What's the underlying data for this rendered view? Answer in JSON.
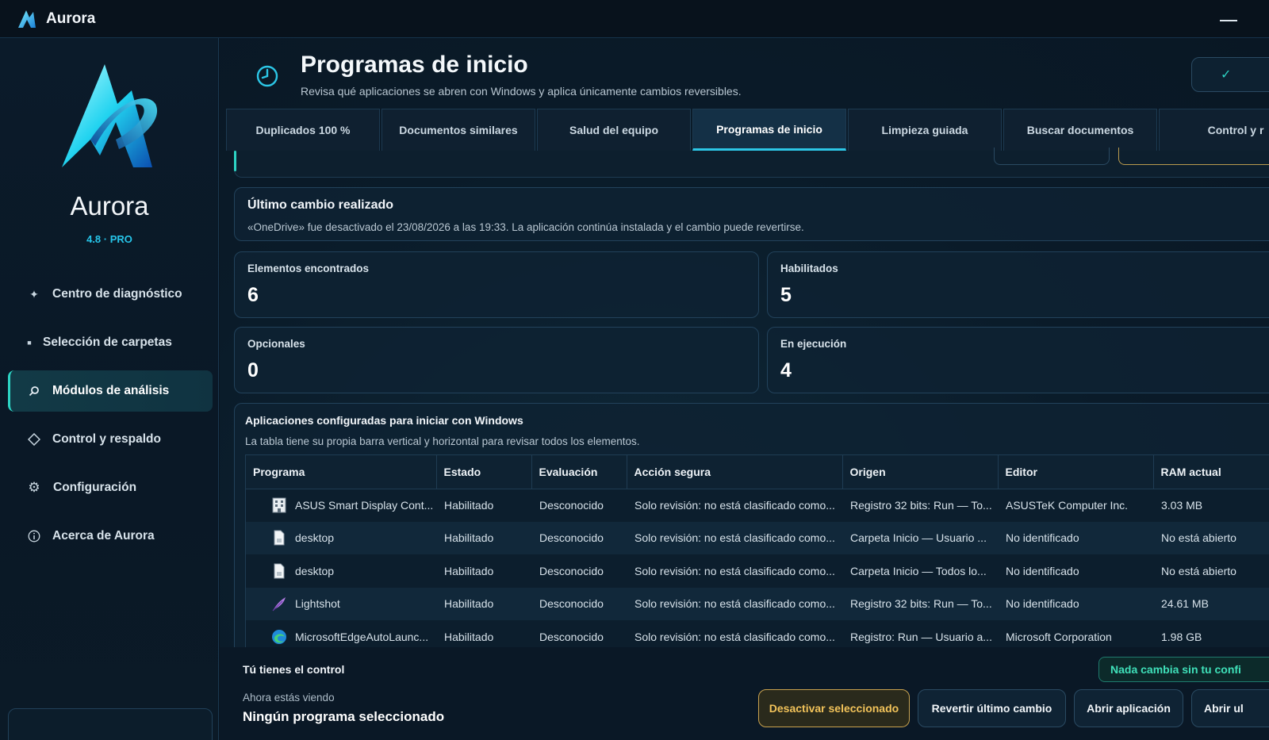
{
  "window": {
    "title": "Aurora"
  },
  "sidebar": {
    "brand_name": "Aurora",
    "version": "4.8 · PRO",
    "items": [
      {
        "label": "Centro de diagnóstico",
        "icon": "sparkle-icon"
      },
      {
        "label": "Selección de carpetas",
        "icon": "folder-icon"
      },
      {
        "label": "Módulos de análisis",
        "icon": "search-icon",
        "active": true
      },
      {
        "label": "Control y respaldo",
        "icon": "diamond-icon"
      },
      {
        "label": "Configuración",
        "icon": "gear-icon"
      },
      {
        "label": "Acerca de Aurora",
        "icon": "info-icon"
      }
    ]
  },
  "header": {
    "title": "Programas de inicio",
    "subtitle": "Revisa qué aplicaciones se abren con Windows y aplica únicamente cambios reversibles."
  },
  "tabs": [
    {
      "label": "Duplicados 100 %"
    },
    {
      "label": "Documentos similares"
    },
    {
      "label": "Salud del equipo"
    },
    {
      "label": "Programas de inicio",
      "active": true
    },
    {
      "label": "Limpieza guiada"
    },
    {
      "label": "Buscar documentos"
    },
    {
      "label": "Control y r"
    }
  ],
  "last_change": {
    "title": "Último cambio realizado",
    "text": "«OneDrive» fue desactivado el 23/08/2026 a las 19:33. La aplicación continúa instalada y el cambio puede revertirse."
  },
  "stats": [
    {
      "label": "Elementos encontrados",
      "value": "6"
    },
    {
      "label": "Habilitados",
      "value": "5"
    },
    {
      "label": "Opcionales",
      "value": "0"
    },
    {
      "label": "En ejecución",
      "value": "4"
    }
  ],
  "apps": {
    "title": "Aplicaciones configuradas para iniciar con Windows",
    "subtitle": "La tabla tiene su propia barra vertical y horizontal para revisar todos los elementos.",
    "columns": [
      "Programa",
      "Estado",
      "Evaluación",
      "Acción segura",
      "Origen",
      "Editor",
      "RAM actual"
    ],
    "rows": [
      {
        "icon": "building-icon",
        "program": "ASUS Smart Display Cont...",
        "state": "Habilitado",
        "eval": "Desconocido",
        "action": "Solo revisión: no está clasificado como...",
        "origin": "Registro 32 bits: Run — To...",
        "editor": "ASUSTeK Computer Inc.",
        "ram": "3.03 MB"
      },
      {
        "icon": "document-icon",
        "program": "desktop",
        "state": "Habilitado",
        "eval": "Desconocido",
        "action": "Solo revisión: no está clasificado como...",
        "origin": "Carpeta Inicio — Usuario ...",
        "editor": "No identificado",
        "ram": "No está abierto"
      },
      {
        "icon": "document-icon",
        "program": "desktop",
        "state": "Habilitado",
        "eval": "Desconocido",
        "action": "Solo revisión: no está clasificado como...",
        "origin": "Carpeta Inicio — Todos lo...",
        "editor": "No identificado",
        "ram": "No está abierto"
      },
      {
        "icon": "feather-icon",
        "program": "Lightshot",
        "state": "Habilitado",
        "eval": "Desconocido",
        "action": "Solo revisión: no está clasificado como...",
        "origin": "Registro 32 bits: Run — To...",
        "editor": "No identificado",
        "ram": "24.61 MB"
      },
      {
        "icon": "edge-icon",
        "program": "MicrosoftEdgeAutoLaunc...",
        "state": "Habilitado",
        "eval": "Desconocido",
        "action": "Solo revisión: no está clasificado como...",
        "origin": "Registro: Run — Usuario a...",
        "editor": "Microsoft Corporation",
        "ram": "1.98 GB"
      }
    ]
  },
  "bottom": {
    "title": "Tú tienes el control",
    "now_label": "Ahora estás viendo",
    "selection": "Ningún programa seleccionado",
    "badge": "Nada cambia sin tu confi",
    "buttons": {
      "disable": "Desactivar seleccionado",
      "revert": "Revertir último cambio",
      "open_app": "Abrir aplicación",
      "open_more": "Abrir ul"
    }
  },
  "colors": {
    "accent": "#2dd4c4",
    "accent_blue": "#2cc6e6",
    "primary_button": "#f2c35a",
    "background": "#0a1622"
  }
}
